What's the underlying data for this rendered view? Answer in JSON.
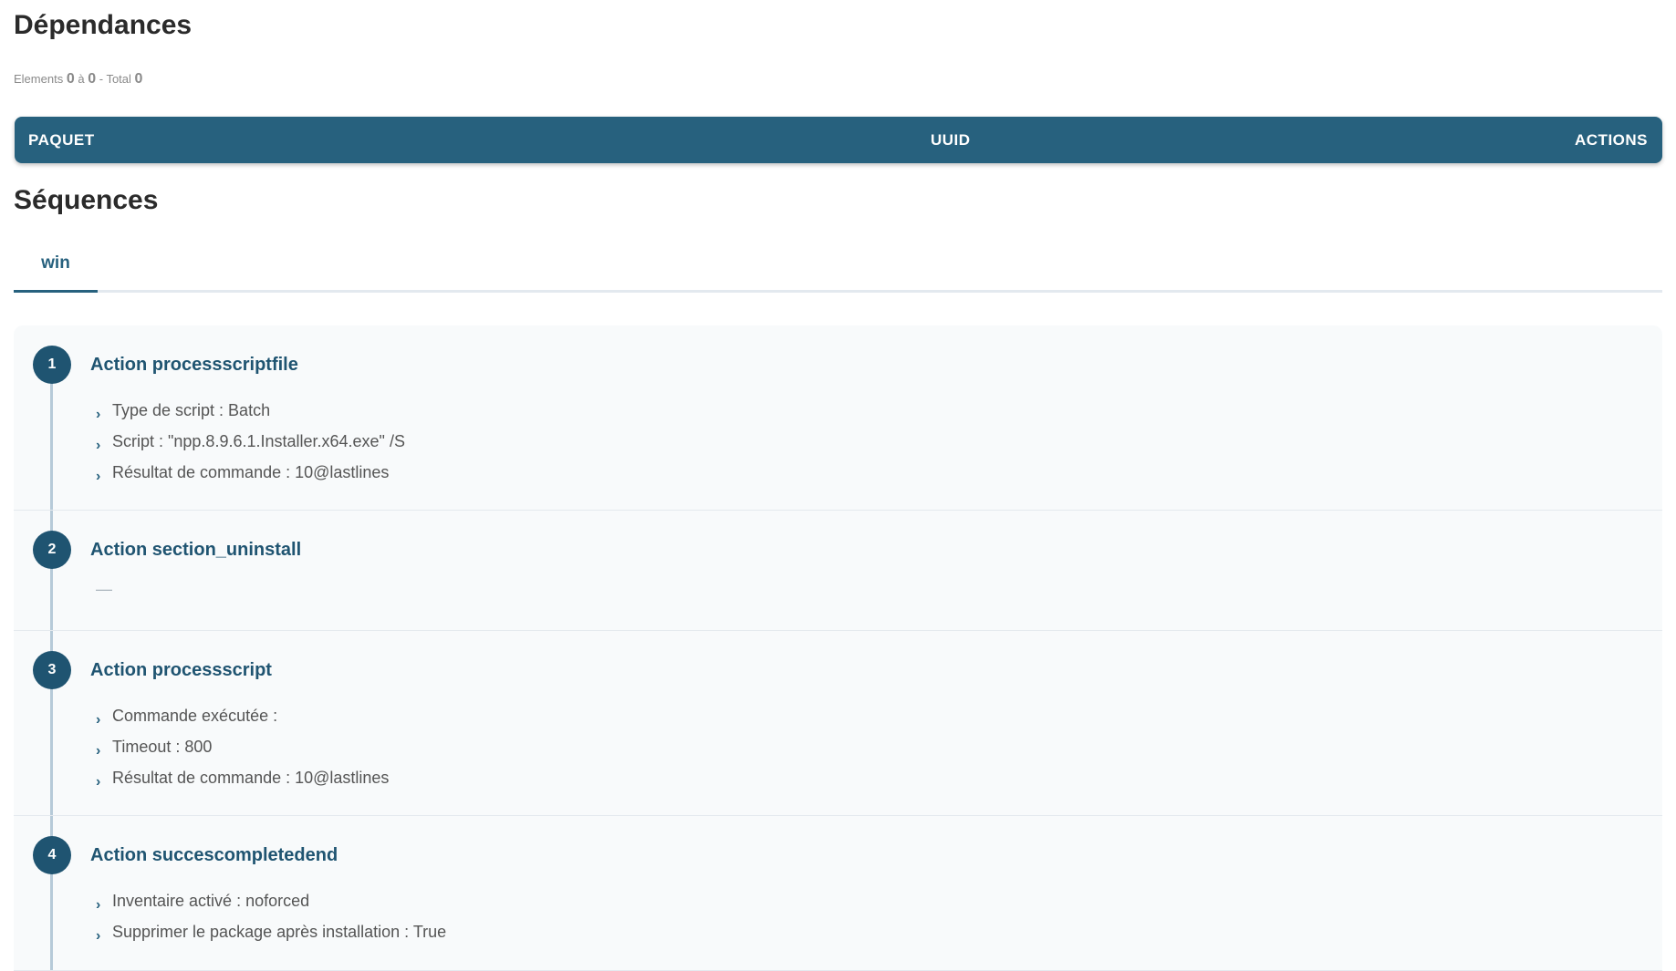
{
  "dependencies": {
    "title": "Dépendances",
    "counter": {
      "elements_label": "Elements",
      "from": "0",
      "to_label": "à",
      "to": "0",
      "total_label": "- Total",
      "total": "0"
    },
    "table": {
      "columns": [
        "PAQUET",
        "UUID",
        "ACTIONS"
      ]
    }
  },
  "sequences": {
    "title": "Séquences",
    "tabs": [
      {
        "label": "win",
        "active": true
      }
    ],
    "steps": [
      {
        "number": "1",
        "title": "Action processscriptfile",
        "details": [
          "Type de script : Batch",
          "Script : \"npp.8.9.6.1.Installer.x64.exe\" /S",
          "Résultat de commande : 10@lastlines"
        ]
      },
      {
        "number": "2",
        "title": "Action section_uninstall",
        "empty_marker": "—",
        "details": []
      },
      {
        "number": "3",
        "title": "Action processscript",
        "details": [
          "Commande exécutée :",
          "Timeout : 800",
          "Résultat de commande : 10@lastlines"
        ]
      },
      {
        "number": "4",
        "title": "Action succescompletedend",
        "details": [
          "Inventaire activé : noforced",
          "Supprimer le package après installation : True"
        ]
      }
    ]
  },
  "icons": {
    "list_bullet": "chevron-right-icon",
    "bullet_glyph": "›"
  },
  "colors": {
    "accent": "#27617e",
    "badge": "#1f5471",
    "timeline": "#b6cad8",
    "panel_bg": "#f8fafb"
  }
}
